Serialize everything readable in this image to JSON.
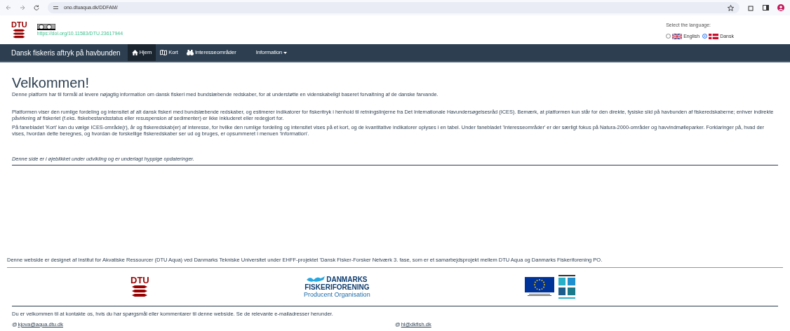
{
  "browser": {
    "url": "ono.dtuaqua.dk/DDFAM/"
  },
  "header": {
    "logo_text": "DTU",
    "doi_link": "https://doi.org/10.11583/DTU.23617944",
    "language_label": "Select the language:",
    "languages": [
      {
        "label": "English",
        "selected": false
      },
      {
        "label": "Dansk",
        "selected": true
      }
    ]
  },
  "navbar": {
    "brand": "Dansk fiskeris aftryk på havbunden",
    "items": [
      {
        "label": "Hjem",
        "selected": true,
        "dropdown": false
      },
      {
        "label": "Kort",
        "selected": false,
        "dropdown": false
      },
      {
        "label": "Interesseområder",
        "selected": false,
        "dropdown": false
      },
      {
        "label": "Information",
        "selected": false,
        "dropdown": true
      }
    ]
  },
  "content": {
    "title": "Velkommen!",
    "intro": "Denne platform har til formål at levere nøjagtig information om dansk fiskeri med bundslæbende redskaber, for at understøtte en videnskabeligt baseret forvaltning af de danske farvande.",
    "paragraphs": [
      "Platformen viser den rumlige fordeling og intensitet af alt dansk fiskeri med bundslæbende redskaber, og estimerer indikatorer for fiskeritryk i henhold til retningslinjerne fra Det Internationale Havundersøgelsesråd (ICES). Bemærk, at platformen kun står for den direkte, fysiske slid på havbunden af fiskeredskaberne; enhver indirekte påvirkning af fiskeriet (f.eks. fiskebestandsstatus eller resuspension af sedimenter) er ikke inkluderet eller redegjort for.",
      "På fanebladet 'Kort' kan du vælge ICES-område(r), år og fiskeredskab(er) af interesse, for hvilke den rumlige fordeling og intensitet vises på et kort, og de kvantitative indikatorer oplyses i en tabel. Under fanebladet 'Interesseområder' er der særligt fokus på Natura-2000-områder og havvindmølleparker. Forklaringer på, hvad der vises, hvordan dette beregnes, og hvordan de forskellige fiskeredskaber ser ud og bruges, er opsummeret i menuen 'Information'."
    ],
    "note": "Denne side er i øjeblikket under udvikling og er underlagt hyppige opdateringer."
  },
  "footer": {
    "credit": "Denne webside er designet af Institut for Akvatiske Ressourcer (DTU Aqua) ved Danmarks Tekniske Universitet under EHFF-projektet 'Dansk Fisker-Forsker Netværk 3. fase, som er et samarbejdsprojekt mellem DTU Aqua og Danmarks Fiskeriforening PO.",
    "dtu_logo_text": "DTU",
    "dfpo_logo": [
      "DANMARKS",
      "FISKERIFORENING",
      "Producent Organisation"
    ],
    "contact_text": "Du er velkommen til at kontakte os, hvis du har spørgsmål eller kommentarer til denne webside. Se de relevante e-mailadresser herunder.",
    "emails": [
      {
        "symbol": "@",
        "address": "kjova@aqua.dtu.dk"
      },
      {
        "symbol": "@",
        "address": "hl@dkfish.dk"
      }
    ]
  }
}
